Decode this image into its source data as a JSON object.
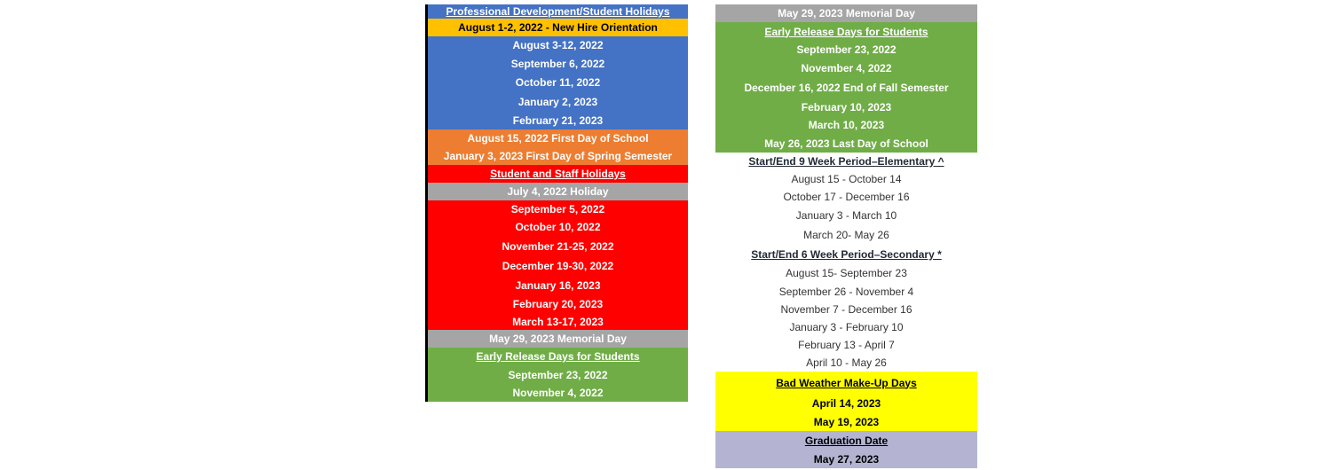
{
  "left_column": {
    "rows": [
      {
        "text": "Professional Development/Student Holidays",
        "style": "blue",
        "underline": true
      },
      {
        "text": "August 1-2, 2022 -  New Hire Orientation",
        "style": "gold"
      },
      {
        "text": "August 3-12, 2022",
        "style": "blue"
      },
      {
        "text": "September 6, 2022",
        "style": "blue"
      },
      {
        "text": "October 11, 2022",
        "style": "blue"
      },
      {
        "text": "January 2, 2023",
        "style": "blue"
      },
      {
        "text": "February 21, 2023",
        "style": "blue"
      },
      {
        "text": "August 15, 2022  First Day of School",
        "style": "orange"
      },
      {
        "text": "January 3, 2023  First Day of Spring Semester",
        "style": "orange"
      },
      {
        "text": "Student and Staff Holidays",
        "style": "red",
        "underline": true
      },
      {
        "text": "July 4, 2022 Holiday",
        "style": "gray"
      },
      {
        "text": "September 5, 2022",
        "style": "red"
      },
      {
        "text": "October 10, 2022",
        "style": "red"
      },
      {
        "text": "November 21-25, 2022",
        "style": "red"
      },
      {
        "text": "December 19-30, 2022",
        "style": "red"
      },
      {
        "text": "January 16, 2023",
        "style": "red"
      },
      {
        "text": "February 20, 2023",
        "style": "red"
      },
      {
        "text": "March 13-17, 2023",
        "style": "red"
      },
      {
        "text": "May 29, 2023 Memorial Day",
        "style": "gray"
      },
      {
        "text": "Early Release Days for Students",
        "style": "green",
        "underline": true
      },
      {
        "text": "September 23, 2022",
        "style": "green"
      },
      {
        "text": "November 4, 2022",
        "style": "green"
      }
    ]
  },
  "right_column": {
    "rows": [
      {
        "text": "May 29, 2023 Memorial Day",
        "style": "gray"
      },
      {
        "text": "Early Release Days for Students",
        "style": "green",
        "underline": true
      },
      {
        "text": "September 23, 2022",
        "style": "green"
      },
      {
        "text": "November 4, 2022",
        "style": "green"
      },
      {
        "text": "December 16, 2022 End of Fall Semester",
        "style": "green"
      },
      {
        "text": "February 10, 2023",
        "style": "green"
      },
      {
        "text": "March 10, 2023",
        "style": "green"
      },
      {
        "text": "May 26, 2023 Last Day of School",
        "style": "green"
      },
      {
        "text": "Start/End 9 Week Period–Elementary ^",
        "style": "white hdr",
        "underline": true
      },
      {
        "text": "August 15 - October 14",
        "style": "white"
      },
      {
        "text": "October 17 - December 16",
        "style": "white"
      },
      {
        "text": "January 3 - March 10",
        "style": "white"
      },
      {
        "text": "March 20- May 26",
        "style": "white"
      },
      {
        "text": "Start/End 6 Week Period–Secondary *",
        "style": "white hdr",
        "underline": true
      },
      {
        "text": "August 15- September 23",
        "style": "white"
      },
      {
        "text": "September 26 - November 4",
        "style": "white"
      },
      {
        "text": "November 7 - December 16",
        "style": "white"
      },
      {
        "text": "January 3 - February 10",
        "style": "white"
      },
      {
        "text": "February 13 - April 7",
        "style": "white"
      },
      {
        "text": "April 10 - May 26",
        "style": "white"
      },
      {
        "text": "Bad Weather Make-Up Days",
        "style": "yellow",
        "underline": true
      },
      {
        "text": "April 14, 2023",
        "style": "yellow"
      },
      {
        "text": "May 19, 2023",
        "style": "yellow"
      },
      {
        "text": "Graduation Date",
        "style": "lav",
        "underline": true
      },
      {
        "text": "May 27, 2023",
        "style": "lav"
      }
    ]
  }
}
